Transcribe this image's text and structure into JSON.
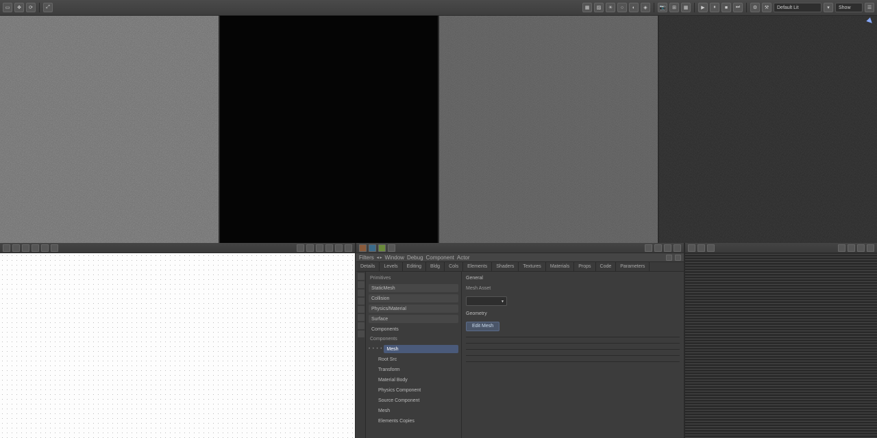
{
  "toolbar": {
    "left_icons": [
      "select-icon",
      "move-icon",
      "scale-icon",
      "divider",
      "options-icon"
    ],
    "right_field": "Default Lit",
    "menu_items": [
      "Camera",
      "Lit",
      "Show"
    ]
  },
  "panels": {
    "grid": {
      "header_icons": [
        "circle-icon",
        "square-icon",
        "line-icon",
        "curve-icon",
        "text-icon",
        "measure-icon",
        "divider",
        "undo-icon",
        "redo-icon"
      ],
      "header_right": [
        "grid-icon",
        "snap-icon",
        "settings-icon"
      ],
      "sidebar_icons": [
        "pan-icon",
        "zoom-icon",
        "fit-icon",
        "layers-icon",
        "grid-toggle-icon",
        "snap-toggle-icon",
        "ruler-icon",
        "guides-icon",
        "lock-icon",
        "info-icon"
      ]
    },
    "editor": {
      "top_label": "Filters",
      "top_menu": [
        "Window",
        "Debug",
        "Component",
        "Actor"
      ],
      "tabs": [
        "Details",
        "Levels",
        "Editing",
        "Bldg",
        "Cols",
        "Elements",
        "Shaders",
        "Textures",
        "Materials",
        "Props",
        "Code",
        "Parameters"
      ],
      "tree": {
        "group1_title": "Primitives",
        "group1_items": [
          "StaticMesh",
          "Collision",
          "Physics/Material",
          "Surface"
        ],
        "group2_title": "Components",
        "selected": "Mesh",
        "dots": "• • • •",
        "group3_items": [
          "Root    Src",
          "Transform",
          "Material  Body",
          "Physics   Component",
          "Source   Component",
          "Mesh",
          "Elements    Copies"
        ]
      },
      "props": {
        "section1": "General",
        "field1_label": "Mesh Asset",
        "field1_value": "",
        "section2": "Geometry",
        "button": "Edit Mesh"
      }
    },
    "lines": {
      "header_icons": [
        "list-icon",
        "tree-icon",
        "filter-icon"
      ],
      "header_right": [
        "search-icon",
        "expand-icon",
        "collapse-icon",
        "menu-icon"
      ]
    }
  }
}
